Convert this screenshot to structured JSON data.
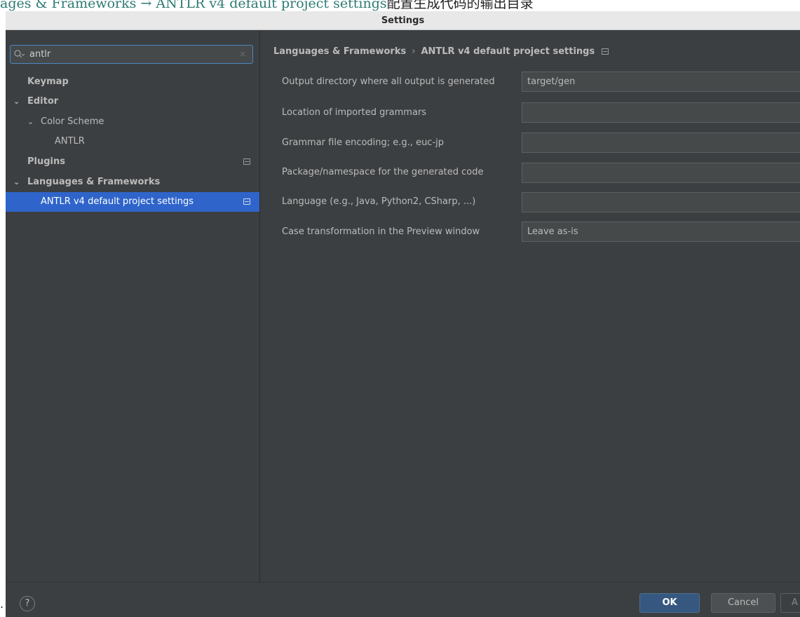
{
  "caption": {
    "breadcrumb_text": "ages & Frameworks → ANTLR v4 default project settings",
    "trailing_text": "配置生成代码的输出目录"
  },
  "bullet": ".",
  "window": {
    "title": "Settings"
  },
  "search": {
    "icon": "search-icon",
    "value": "antlr",
    "clear_icon": "×"
  },
  "tree": {
    "keymap": "Keymap",
    "editor": "Editor",
    "color_scheme": "Color Scheme",
    "antlr": "ANTLR",
    "plugins": "Plugins",
    "languages": "Languages & Frameworks",
    "antlr_settings": "ANTLR v4 default project settings"
  },
  "breadcrumb": {
    "parent": "Languages & Frameworks",
    "separator": "›",
    "current": "ANTLR v4 default project settings"
  },
  "fields": {
    "output_dir": {
      "label": "Output directory where all output is generated",
      "value": "target/gen"
    },
    "imported_grammars": {
      "label": "Location of imported grammars",
      "value": ""
    },
    "encoding": {
      "label": "Grammar file encoding; e.g., euc-jp",
      "value": ""
    },
    "package": {
      "label": "Package/namespace for the generated code",
      "value": ""
    },
    "language": {
      "label": "Language (e.g., Java, Python2, CSharp, ...)",
      "value": ""
    },
    "case_transform": {
      "label": "Case transformation in the Preview window",
      "value": "Leave as-is"
    }
  },
  "footer": {
    "help": "?",
    "ok": "OK",
    "cancel": "Cancel",
    "apply": "A"
  },
  "colors": {
    "selection": "#2f65ca",
    "ok_button": "#365880",
    "background": "#3c3f41"
  }
}
